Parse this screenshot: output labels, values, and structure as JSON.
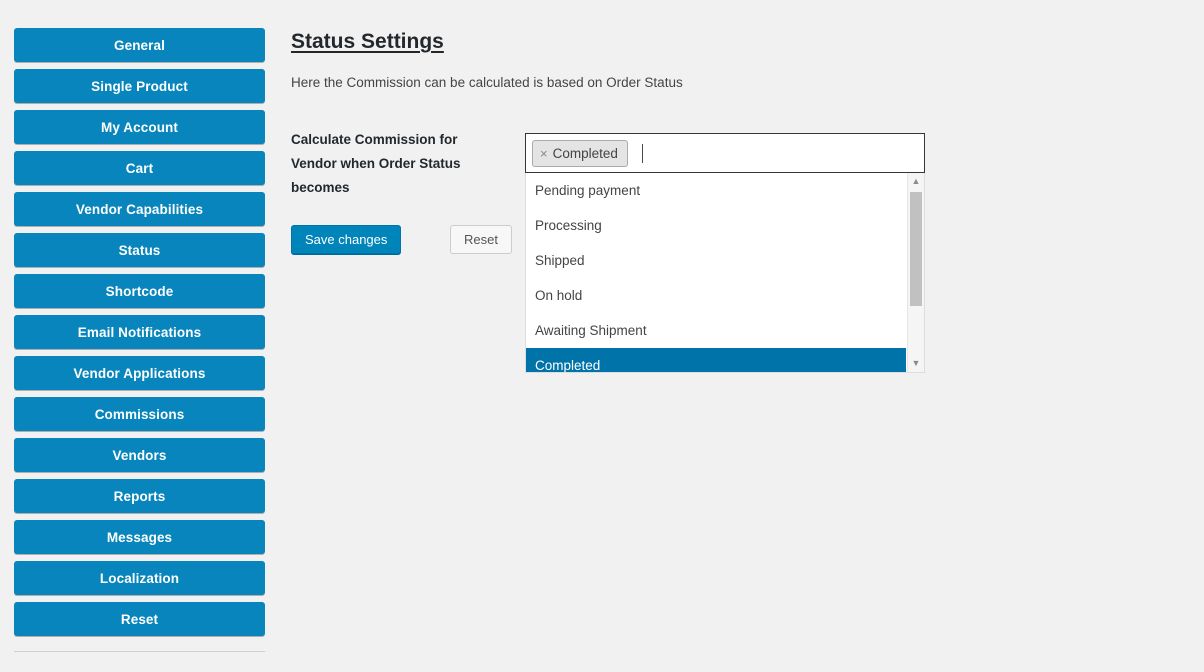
{
  "sidebar": {
    "items": [
      {
        "label": "General"
      },
      {
        "label": "Single Product"
      },
      {
        "label": "My Account"
      },
      {
        "label": "Cart"
      },
      {
        "label": "Vendor Capabilities"
      },
      {
        "label": "Status"
      },
      {
        "label": "Shortcode"
      },
      {
        "label": "Email Notifications"
      },
      {
        "label": "Vendor Applications"
      },
      {
        "label": "Commissions"
      },
      {
        "label": "Vendors"
      },
      {
        "label": "Reports"
      },
      {
        "label": "Messages"
      },
      {
        "label": "Localization"
      },
      {
        "label": "Reset"
      }
    ]
  },
  "main": {
    "title": "Status Settings",
    "description": "Here the Commission can be calculated is based on Order Status",
    "field": {
      "label": "Calculate Commission for Vendor when Order Status becomes",
      "help_icon": "help-circle-icon",
      "help_glyph": "?",
      "selected_tokens": [
        {
          "label": "Completed",
          "remove_glyph": "×"
        }
      ],
      "input_value": "",
      "input_placeholder": "",
      "dropdown_options": [
        {
          "label": "Pending payment",
          "selected": false
        },
        {
          "label": "Processing",
          "selected": false
        },
        {
          "label": "Shipped",
          "selected": false
        },
        {
          "label": "On hold",
          "selected": false
        },
        {
          "label": "Awaiting Shipment",
          "selected": false
        },
        {
          "label": "Completed",
          "selected": true
        }
      ],
      "scrollbar": {
        "up_glyph": "▲",
        "down_glyph": "▼"
      }
    },
    "buttons": {
      "save_label": "Save changes",
      "reset_label": "Reset"
    }
  },
  "colors": {
    "page_background": "#f1f1f1",
    "sidebar_button": "#0785bc",
    "save_button": "#0085ba",
    "dropdown_highlight": "#0073a8",
    "text": "#444444"
  }
}
